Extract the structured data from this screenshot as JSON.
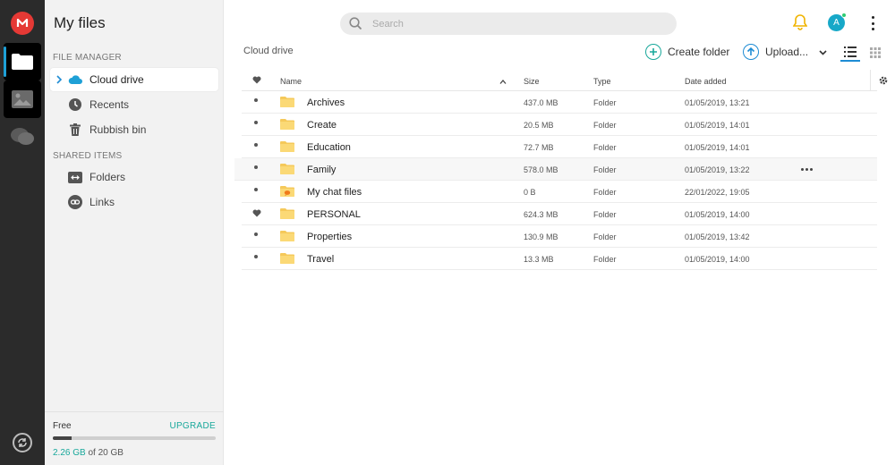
{
  "app": {
    "title": "My files"
  },
  "sidebar": {
    "file_manager_label": "FILE MANAGER",
    "items": [
      {
        "label": "Cloud drive",
        "icon": "cloud-icon",
        "active": true
      },
      {
        "label": "Recents",
        "icon": "clock-icon"
      },
      {
        "label": "Rubbish bin",
        "icon": "trash-icon"
      }
    ],
    "shared_label": "SHARED ITEMS",
    "shared_items": [
      {
        "label": "Folders",
        "icon": "shared-folder-icon"
      },
      {
        "label": "Links",
        "icon": "link-icon"
      }
    ]
  },
  "storage": {
    "plan": "Free",
    "upgrade": "UPGRADE",
    "used": "2.26 GB",
    "total_text": "of 20 GB",
    "used_fraction": 0.113
  },
  "header": {
    "search_placeholder": "Search",
    "avatar_initial": "A"
  },
  "toolbar": {
    "breadcrumb": "Cloud drive",
    "create_folder": "Create folder",
    "upload": "Upload..."
  },
  "table": {
    "columns": {
      "name": "Name",
      "size": "Size",
      "type": "Type",
      "date": "Date added"
    },
    "rows": [
      {
        "name": "Archives",
        "size": "437.0 MB",
        "type": "Folder",
        "date": "01/05/2019, 13:21",
        "fav": false
      },
      {
        "name": "Create",
        "size": "20.5 MB",
        "type": "Folder",
        "date": "01/05/2019, 14:01",
        "fav": false
      },
      {
        "name": "Education",
        "size": "72.7 MB",
        "type": "Folder",
        "date": "01/05/2019, 14:01",
        "fav": false
      },
      {
        "name": "Family",
        "size": "578.0 MB",
        "type": "Folder",
        "date": "01/05/2019, 13:22",
        "fav": false,
        "hover": true
      },
      {
        "name": "My chat files",
        "size": "0 B",
        "type": "Folder",
        "date": "22/01/2022, 19:05",
        "fav": false,
        "special": true
      },
      {
        "name": "PERSONAL",
        "size": "624.3 MB",
        "type": "Folder",
        "date": "01/05/2019, 14:00",
        "fav": true
      },
      {
        "name": "Properties",
        "size": "130.9 MB",
        "type": "Folder",
        "date": "01/05/2019, 13:42",
        "fav": false
      },
      {
        "name": "Travel",
        "size": "13.3 MB",
        "type": "Folder",
        "date": "01/05/2019, 14:00",
        "fav": false
      }
    ]
  },
  "colors": {
    "accent_teal": "#19a89b",
    "accent_blue": "#1e8cd4",
    "brand_red": "#e53935",
    "folder": "#f5c95a"
  }
}
